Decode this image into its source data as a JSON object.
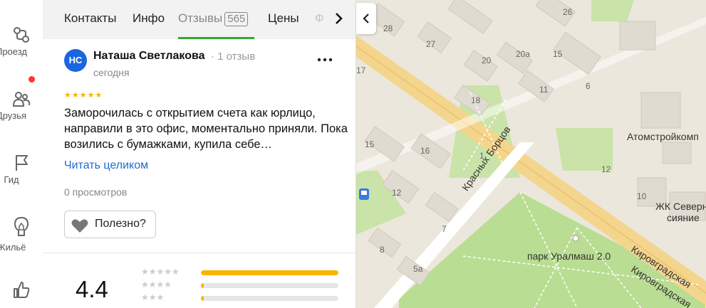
{
  "rail": {
    "items": [
      {
        "label": "Проезд",
        "icon": "route-icon"
      },
      {
        "label": "Друзья",
        "icon": "friends-icon"
      },
      {
        "label": "Гид",
        "icon": "flag-icon"
      },
      {
        "label": "Жильё",
        "icon": "housing-icon"
      },
      {
        "label": "",
        "icon": "thumbs-up-icon"
      }
    ],
    "notification_color": "#ff3333"
  },
  "tabs": {
    "items": [
      {
        "label": "Контакты"
      },
      {
        "label": "Инфо"
      },
      {
        "label": "Отзывы",
        "count": "565",
        "active": true
      },
      {
        "label": "Цены"
      },
      {
        "label": "Ф"
      }
    ],
    "accent": "#33aa33"
  },
  "review": {
    "initials": "НС",
    "author": "Наташа Светлакова",
    "author_meta": "· 1 отзыв",
    "date": "сегодня",
    "stars": "★★★★★",
    "rating_value": 5,
    "text": "Заморочилась с открытием счета как юрлицо, направили в это офис, моментально приняли. Пока возились с бумажками, купила себе…",
    "read_more": "Читать целиком",
    "views": "0 просмотров",
    "helpful_label": "Полезно?"
  },
  "summary": {
    "rating": "4.4",
    "distribution": [
      {
        "stars": "★★★★★",
        "fraction": 1.0
      },
      {
        "stars": "★★★★",
        "fraction": 0.02
      },
      {
        "stars": "★★★",
        "fraction": 0.02
      }
    ],
    "bar_color": "#f7b500"
  },
  "map": {
    "labels": [
      "28",
      "27",
      "26",
      "20",
      "20а",
      "15",
      "11",
      "6",
      "18",
      "17",
      "16",
      "15",
      "12",
      "1",
      "7",
      "8",
      "5а",
      "12",
      "10"
    ],
    "streets": [
      "Красных Борцов",
      "Кировградская",
      "Кировградская"
    ],
    "places": [
      "Атомстройкомп",
      "ЖК Северн",
      "сияние",
      "парк Уралмаш 2.0"
    ]
  }
}
